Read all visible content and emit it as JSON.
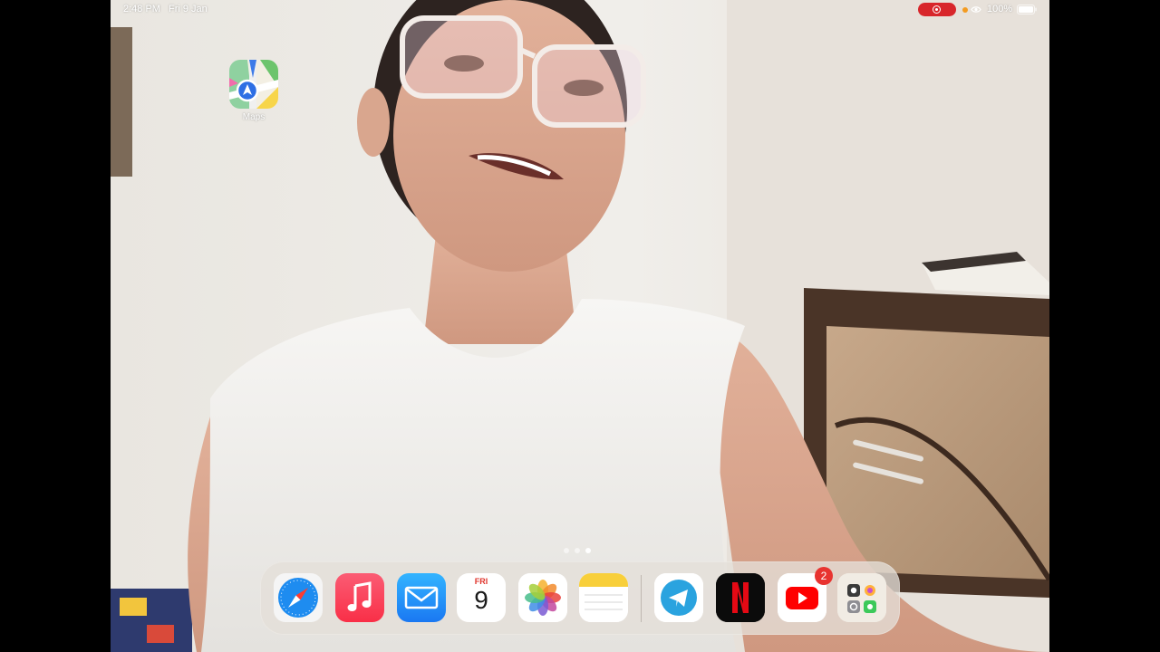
{
  "status_bar": {
    "time": "2:48 PM",
    "date": "Fri 9 Jan",
    "battery": "100%",
    "recording_color": "#d8262b"
  },
  "home": {
    "apps": [
      {
        "label": "Maps",
        "icon": "maps-icon"
      }
    ],
    "page_count": 3,
    "current_page": 3
  },
  "dock": {
    "apps": [
      {
        "icon": "safari-icon"
      },
      {
        "icon": "music-icon"
      },
      {
        "icon": "mail-icon"
      },
      {
        "icon": "calendar-icon",
        "day": "FRI",
        "date": "9"
      },
      {
        "icon": "photos-icon"
      },
      {
        "icon": "notes-icon"
      },
      {
        "icon": "telegram-icon"
      },
      {
        "icon": "netflix-icon"
      },
      {
        "icon": "youtube-icon",
        "badge": "2"
      },
      {
        "icon": "app-library-icon"
      }
    ]
  }
}
